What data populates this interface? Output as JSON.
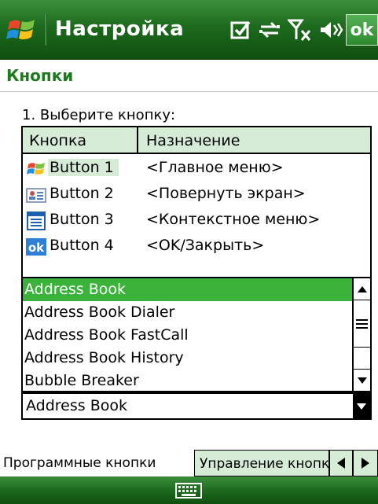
{
  "titlebar": {
    "title": "Настройка",
    "ok_label": "ok",
    "status_icons": [
      "task-check-icon",
      "connectivity-icon",
      "no-signal-icon",
      "speaker-icon"
    ]
  },
  "page": {
    "header": "Кнопки",
    "instruction": "1. Выберите кнопку:"
  },
  "button_table": {
    "columns": [
      "Кнопка",
      "Назначение"
    ],
    "rows": [
      {
        "button": "Button 1",
        "assignment": "<Главное меню>",
        "icon": "windows-flag-icon"
      },
      {
        "button": "Button 2",
        "assignment": "<Повернуть экран>",
        "icon": "contact-card-icon"
      },
      {
        "button": "Button 3",
        "assignment": "<Контекстное меню>",
        "icon": "context-menu-icon"
      },
      {
        "button": "Button 4",
        "assignment": "<OK/Закрыть>",
        "icon": "ok-icon"
      }
    ]
  },
  "program_list": {
    "items": [
      "Address Book",
      "Address Book Dialer",
      "Address Book FastCall",
      "Address Book History",
      "Bubble Breaker"
    ],
    "selected_index": 0
  },
  "dropdown": {
    "value": "Address Book"
  },
  "tabs": {
    "active": "Программные кнопки",
    "inactive": "Управление кнопками"
  },
  "colors": {
    "accent_green": "#1e7a1e",
    "selection_green": "#3bb33b",
    "header_tint": "#d6ecd6"
  }
}
